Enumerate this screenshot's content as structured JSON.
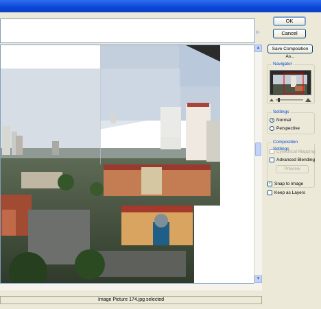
{
  "buttons": {
    "ok": "OK",
    "cancel": "Cancel",
    "save_composition": "Save Composition As..."
  },
  "navigator": {
    "title": "Navigator"
  },
  "settings": {
    "title": "Settings",
    "normal": "Normal",
    "perspective": "Perspective",
    "selected": "Normal"
  },
  "composition_settings": {
    "title": "Composition Settings",
    "cylindrical_mapping": "Cylindrical Mapping",
    "advanced_blending": "Advanced Blending",
    "preview": "Preview"
  },
  "options": {
    "snap_to_image": "Snap to Image",
    "snap_checked": true,
    "keep_as_layers": "Keep as Layers",
    "keep_checked": false
  },
  "status": {
    "text": "Image Picture 174.jpg selected"
  },
  "colors": {
    "accent": "#0046d5",
    "title_bar": "#0a46d8"
  },
  "icons": {
    "scroll_right": "chevron-right-icon",
    "scroll_up": "chevron-up-icon",
    "scroll_down": "chevron-down-icon",
    "zoom_out": "mountain-small-icon",
    "zoom_in": "mountain-large-icon"
  }
}
